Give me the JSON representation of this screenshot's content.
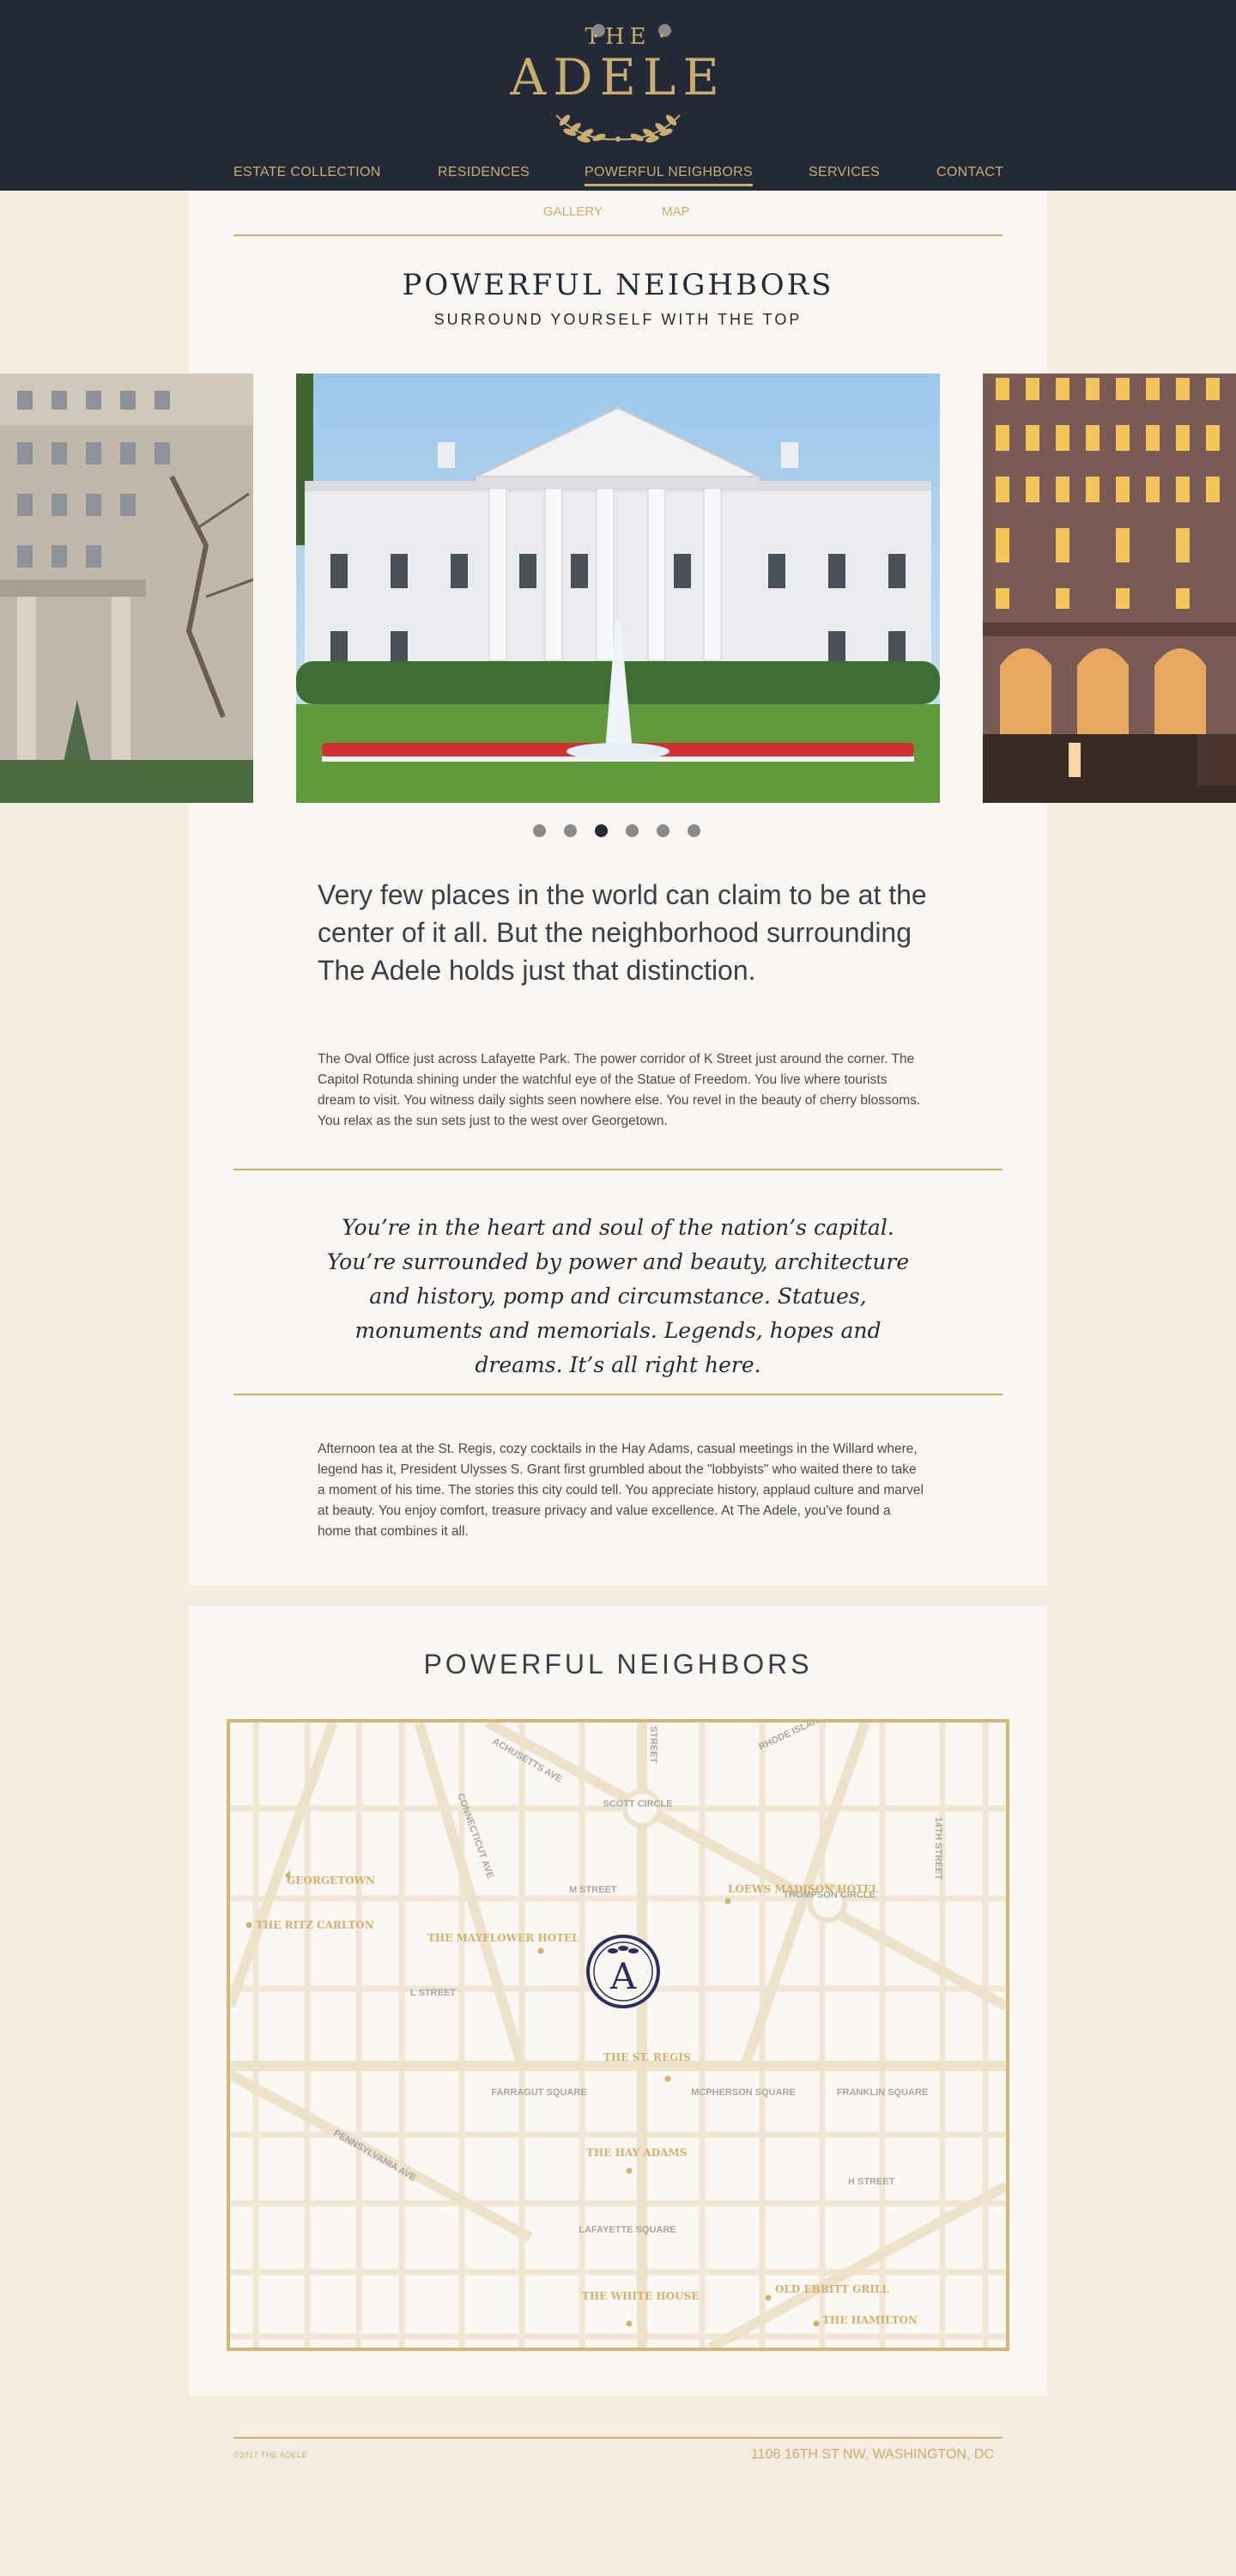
{
  "brand": {
    "the": "THE",
    "name": "ADELE"
  },
  "nav": {
    "items": [
      {
        "label": "ESTATE COLLECTION"
      },
      {
        "label": "RESIDENCES"
      },
      {
        "label": "POWERFUL NEIGHBORS"
      },
      {
        "label": "SERVICES"
      },
      {
        "label": "CONTACT"
      }
    ],
    "active": "POWERFUL NEIGHBORS"
  },
  "subnav": {
    "gallery": "GALLERY",
    "map": "MAP"
  },
  "hero": {
    "title": "POWERFUL NEIGHBORS",
    "subtitle": "SURROUND YOURSELF WITH THE TOP"
  },
  "carousel": {
    "count": 6,
    "active_index": 2
  },
  "content": {
    "lead": "Very few places in the world can claim to be at the center of it all. But the neighborhood surrounding The Adele holds just that distinction.",
    "para1": "The Oval Office just across Lafayette Park. The power corridor of K Street just around the corner. The Capitol Rotunda shining under the watchful eye of the Statue of Freedom. You live where tourists dream to visit. You witness daily sights seen nowhere else. You revel in the beauty of cherry blossoms. You relax as the sun sets just to the west over Georgetown.",
    "quote": "You’re in the heart and soul of the nation’s capital. You’re surrounded by power and beauty, architecture and history, pomp and circumstance. Statues, monuments and memorials. Legends, hopes and dreams. It’s all right here.",
    "para2": "Afternoon tea at the St. Regis, cozy cocktails in the Hay Adams, casual meetings in the Willard where, legend has it, President Ulysses S. Grant first grumbled about the \"lobbyists\" who waited there to take a moment of his time. The stories this city could tell. You appreciate history, applaud culture and marvel at beauty. You enjoy comfort, treasure privacy and value excellence. At The Adele, you've found a home that combines it all."
  },
  "map": {
    "title": "POWERFUL NEIGHBORS",
    "streets": {
      "massachusetts": "ACHUSETTS AVE",
      "rhode_island": "RHODE ISLAND",
      "street_16": "STREET",
      "scott_circle": "SCOTT CIRCLE",
      "connecticut": "CONNECTICUT AVE",
      "street_14": "14TH STREET",
      "m_street": "M STREET",
      "thompson_circle": "THOMPSON CIRCLE",
      "l_street": "L STREET",
      "farragut": "FARRAGUT SQUARE",
      "mcpherson": "MCPHERSON SQUARE",
      "franklin": "FRANKLIN SQUARE",
      "pennsylvania": "PENNSYLVANIA AVE",
      "h_street": "H STREET",
      "lafayette": "LAFAYETTE SQUARE"
    },
    "places": {
      "georgetown": "GEORGETOWN",
      "ritz": "THE RITZ CARLTON",
      "mayflower": "THE MAYFLOWER HOTEL",
      "loews": "LOEWS MADISON HOTEL",
      "st_regis": "THE ST. REGIS",
      "hay_adams": "THE HAY ADAMS",
      "white_house": "THE WHITE HOUSE",
      "old_ebbitt": "OLD EBBITT GRILL",
      "hamilton": "THE HAMILTON"
    },
    "marker": "A"
  },
  "footer": {
    "copyright": "©2017 THE ADELE",
    "address": "1108 16TH ST NW, WASHINGTON, DC"
  },
  "colors": {
    "navy": "#232936",
    "gold": "#c9ac70",
    "cream": "#f4ece0",
    "card": "#faf7f2"
  }
}
